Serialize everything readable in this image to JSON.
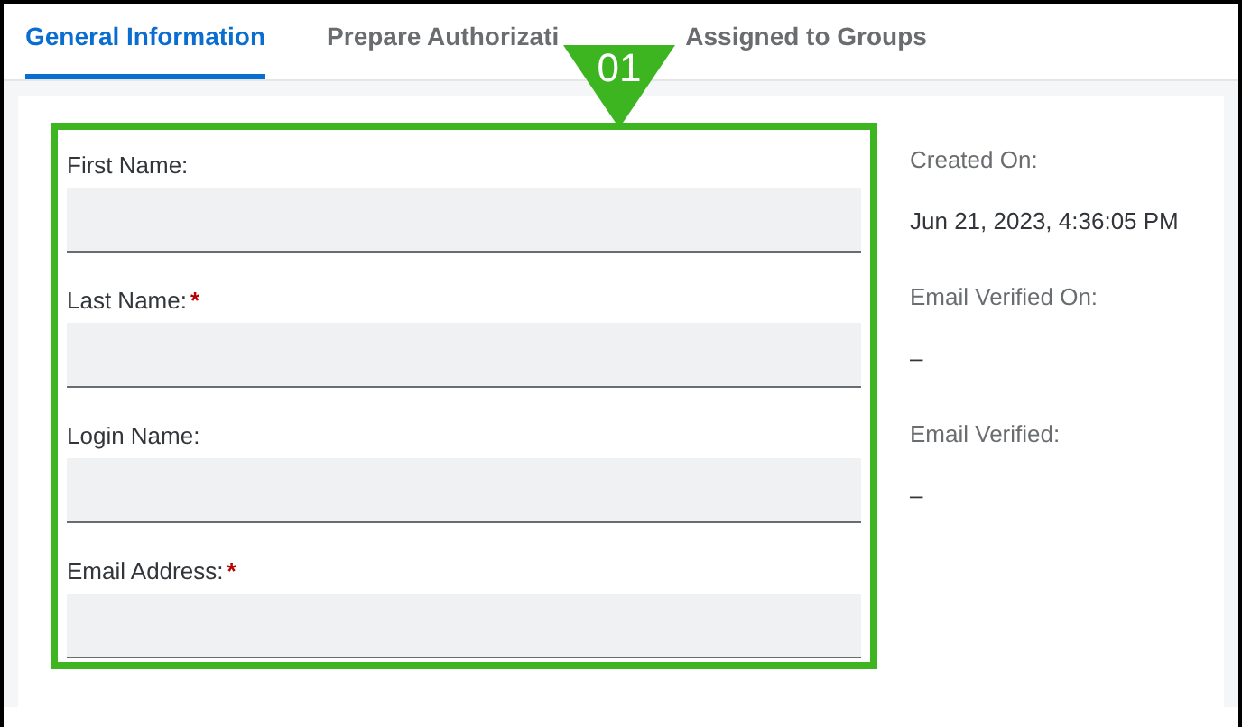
{
  "tabs": [
    {
      "label": "General Information",
      "selected": true
    },
    {
      "label": "Prepare Authorizati",
      "selected": false
    },
    {
      "label": "Assigned to Groups",
      "selected": false
    }
  ],
  "callout": {
    "label": "01"
  },
  "fields": [
    {
      "label": "First Name:"
    },
    {
      "label": "Last Name:",
      "required_mark": "*"
    },
    {
      "label": "Login Name:"
    },
    {
      "label": "Email Address:",
      "required_mark": "*"
    }
  ],
  "details": [
    {
      "label": "Created On:",
      "value": "Jun 21, 2023, 4:36:05 PM"
    },
    {
      "label": "Email Verified On:",
      "value": "–"
    },
    {
      "label": "Email Verified:",
      "value": "–"
    }
  ]
}
